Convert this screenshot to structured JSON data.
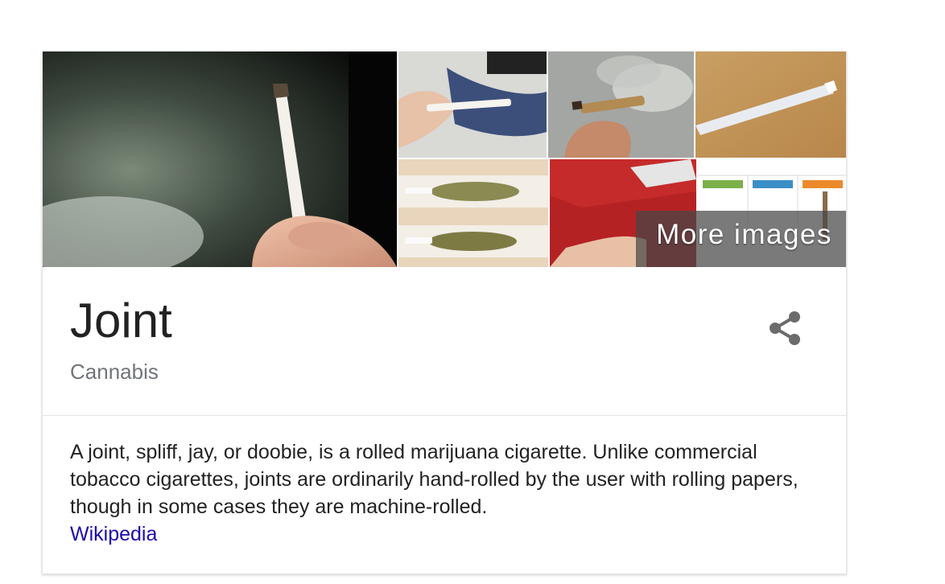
{
  "gallery": {
    "more_images_label": "More images",
    "thumbnails": [
      {
        "name": "hand-holding-joint-main"
      },
      {
        "name": "rolling-joint-on-jeans"
      },
      {
        "name": "smoking-joint-closeup"
      },
      {
        "name": "rolled-joint-on-tan"
      },
      {
        "name": "rolling-papers-with-cannabis"
      },
      {
        "name": "red-rolling-paper-pack"
      },
      {
        "name": "joint-diagram-labels"
      }
    ]
  },
  "entity": {
    "title": "Joint",
    "subtitle": "Cannabis"
  },
  "share": {
    "icon": "share-icon"
  },
  "description": {
    "text": "A joint, spliff, jay, or doobie, is a rolled marijuana cigarette. Unlike commercial tobacco cigarettes, joints are ordinarily hand-rolled by the user with rolling papers, though in some cases they are machine-rolled.",
    "source_label": "Wikipedia"
  },
  "colors": {
    "title": "#222222",
    "subtitle": "#70757a",
    "link": "#1a0dab",
    "overlay": "#464646"
  }
}
